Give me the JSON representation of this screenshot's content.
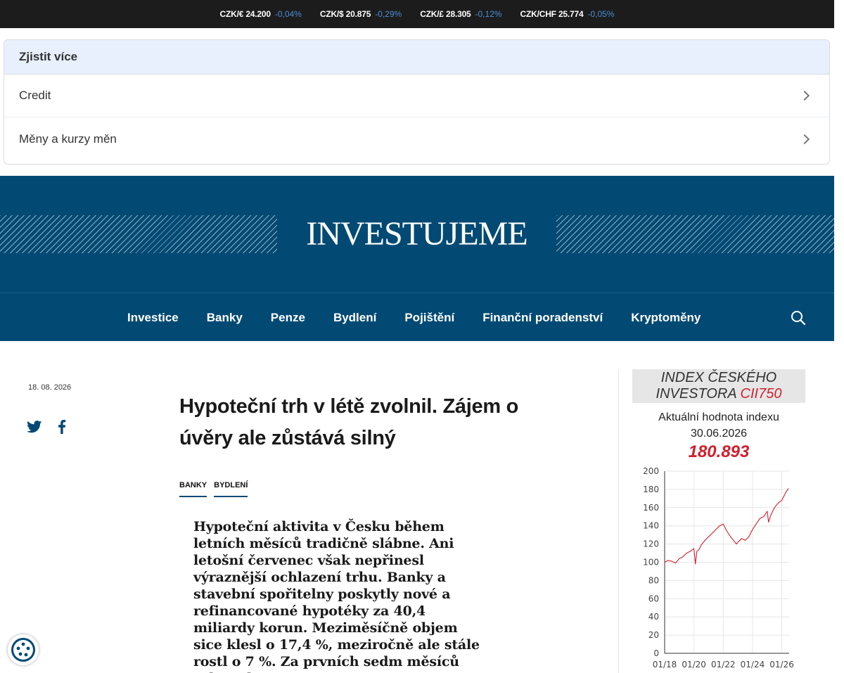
{
  "ticker": [
    {
      "pair": "CZK/€ 24.200",
      "change": "-0,04%"
    },
    {
      "pair": "CZK/$ 20.875",
      "change": "-0,29%"
    },
    {
      "pair": "CZK/£ 28.305",
      "change": "-0,12%"
    },
    {
      "pair": "CZK/CHF 25.774",
      "change": "-0,05%"
    }
  ],
  "learn_more": {
    "title": "Zjistit více",
    "items": [
      {
        "label": "Credit"
      },
      {
        "label": "Měny a kurzy měn"
      }
    ]
  },
  "header": {
    "logo": "INVESTUJEME"
  },
  "nav": {
    "items": [
      {
        "label": "Investice"
      },
      {
        "label": "Banky"
      },
      {
        "label": "Penze"
      },
      {
        "label": "Bydlení"
      },
      {
        "label": "Pojištění"
      },
      {
        "label": "Finanční poradenství"
      },
      {
        "label": "Kryptoměny"
      }
    ]
  },
  "article": {
    "date": "18. 08. 2026",
    "title": "Hypoteční trh v létě zvolnil. Zájem o úvěry ale zůstává silný",
    "tags": [
      {
        "label": "BANKY"
      },
      {
        "label": "BYDLENÍ"
      }
    ],
    "lead": "Hypoteční aktivita v Česku během letních měsíců tradičně slábne. Ani letošní červenec však nepřinesl výraznější ochlazení trhu. Banky a stavební spořitelny poskytly nové a refinancované hypotéky za 40,4 miliardy korun. Meziměsíčně objem sice klesl o 17,4 %, meziročně ale stále rostl o 7 %. Za prvních sedm měsíců roku tak"
  },
  "sidebar": {
    "index_title": "INDEX ČESKÉHO INVESTORA",
    "index_code": "CII750",
    "subtitle": "Aktuální hodnota indexu",
    "date": "30.06.2026",
    "value": "180.893"
  },
  "chart_data": {
    "type": "line",
    "title": "",
    "xlabel": "",
    "ylabel": "",
    "ylim": [
      0,
      200
    ],
    "yticks": [
      0,
      20,
      40,
      60,
      80,
      100,
      120,
      140,
      160,
      180,
      200
    ],
    "xlim": [
      2018.0,
      2026.5
    ],
    "xticks": [
      {
        "label": "01/18",
        "x": 2018.0
      },
      {
        "label": "01/20",
        "x": 2020.0
      },
      {
        "label": "01/22",
        "x": 2022.0
      },
      {
        "label": "01/24",
        "x": 2024.0
      },
      {
        "label": "01/26",
        "x": 2026.0
      }
    ],
    "grid": true,
    "color": "#d0202e",
    "series": [
      {
        "x": [
          2018.0,
          2018.25,
          2018.5,
          2018.75,
          2019.0,
          2019.25,
          2019.5,
          2019.75,
          2020.0,
          2020.1,
          2020.2,
          2020.35,
          2020.5,
          2020.75,
          2021.0,
          2021.25,
          2021.5,
          2021.75,
          2022.0,
          2022.25,
          2022.5,
          2022.75,
          2022.9,
          2023.0,
          2023.25,
          2023.5,
          2023.75,
          2024.0,
          2024.25,
          2024.5,
          2024.75,
          2025.0,
          2025.1,
          2025.25,
          2025.5,
          2025.75,
          2026.0,
          2026.25,
          2026.45
        ],
        "y": [
          100,
          102,
          101,
          99,
          104,
          106,
          110,
          112,
          115,
          98,
          112,
          114,
          119,
          124,
          128,
          132,
          136,
          140,
          142,
          134,
          128,
          123,
          120,
          122,
          126,
          124,
          128,
          136,
          142,
          148,
          150,
          156,
          144,
          152,
          160,
          165,
          168,
          176,
          181
        ]
      }
    ]
  },
  "icons": {
    "search": "search-icon",
    "twitter": "twitter-icon",
    "facebook": "facebook-icon",
    "chevron": "chevron-right-icon",
    "cookie": "cookie-icon"
  },
  "colors": {
    "brand": "#024a74",
    "ticker_bg": "#1c1c1c",
    "ticker_change": "#4a8fd6",
    "accent_red": "#d0202e"
  }
}
